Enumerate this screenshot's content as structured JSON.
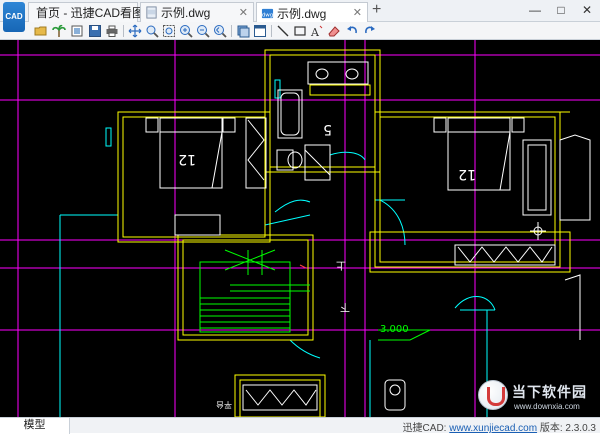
{
  "tabs": [
    {
      "label": "首页 - 迅捷CAD看图",
      "icon": "home-icon"
    },
    {
      "label": "示例.dwg",
      "icon": "dwg-file-icon"
    },
    {
      "label": "示例.dwg",
      "icon": "dwg-file-icon",
      "active": true
    }
  ],
  "add_tab_label": "+",
  "window_controls": {
    "minimize": "—",
    "maximize": "□",
    "close": "✕"
  },
  "toolbar_icons": [
    "open-folder-icon",
    "palm-icon",
    "print-preview-icon",
    "save-icon",
    "print-icon",
    "pan-icon",
    "zoom-window-icon",
    "zoom-extents-icon",
    "zoom-in-icon",
    "zoom-out-icon",
    "zoom-previous-icon",
    "layers-icon",
    "layout-icon",
    "line-icon",
    "rectangle-icon",
    "text-icon",
    "eraser-icon",
    "undo-icon",
    "redo-icon"
  ],
  "canvas": {
    "room_labels": [
      "12",
      "5",
      "12"
    ],
    "stair_labels": [
      "上",
      "下"
    ],
    "elevation_label": "3.000",
    "small_text": "平台"
  },
  "statusbar": {
    "model_tab": "模型",
    "app_prefix": "迅捷CAD:",
    "url": "www.xunjiecad.com",
    "version_label": "版本:",
    "version": "2.3.0.3"
  },
  "watermark": {
    "title": "当下软件园",
    "url": "www.downxia.com"
  },
  "colors": {
    "background": "#000000",
    "walls": "#ffff00",
    "axis": "#ff00ff",
    "furniture": "#ffffff",
    "doors": "#00ffff",
    "stairs": "#00ff00"
  }
}
